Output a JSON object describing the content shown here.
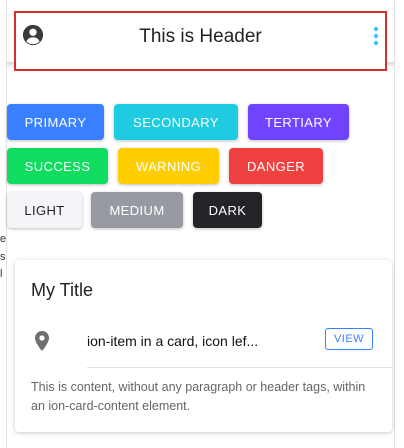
{
  "header": {
    "title": "This is Header"
  },
  "buttons": [
    {
      "label": "PRIMARY",
      "color": "#3880ff",
      "text_color": "#ffffff"
    },
    {
      "label": "SECONDARY",
      "color": "#1ecbe1",
      "text_color": "#ffffff"
    },
    {
      "label": "TERTIARY",
      "color": "#7044ff",
      "text_color": "#ffffff"
    },
    {
      "label": "SUCCESS",
      "color": "#10dc60",
      "text_color": "#ffffff"
    },
    {
      "label": "WARNING",
      "color": "#ffce00",
      "text_color": "#ffffff"
    },
    {
      "label": "DANGER",
      "color": "#f04141",
      "text_color": "#ffffff"
    },
    {
      "label": "LIGHT",
      "color": "#f4f5f8",
      "text_color": "#222428"
    },
    {
      "label": "MEDIUM",
      "color": "#989aa2",
      "text_color": "#ffffff"
    },
    {
      "label": "DARK",
      "color": "#222428",
      "text_color": "#ffffff"
    }
  ],
  "card": {
    "title": "My Title",
    "item_label": "ion-item in a card, icon lef...",
    "view_label": "VIEW",
    "content": "This is content, without any paragraph or header tags, within an ion-card-content element."
  },
  "edge_fragments": [
    "e",
    "s",
    "l"
  ],
  "icons": {
    "avatar": "person-circle-icon",
    "more": "more-vertical-icon",
    "pin": "location-pin-icon"
  },
  "colors": {
    "header_border": "#d32f2f",
    "more_icon": "#3dc2ff"
  }
}
